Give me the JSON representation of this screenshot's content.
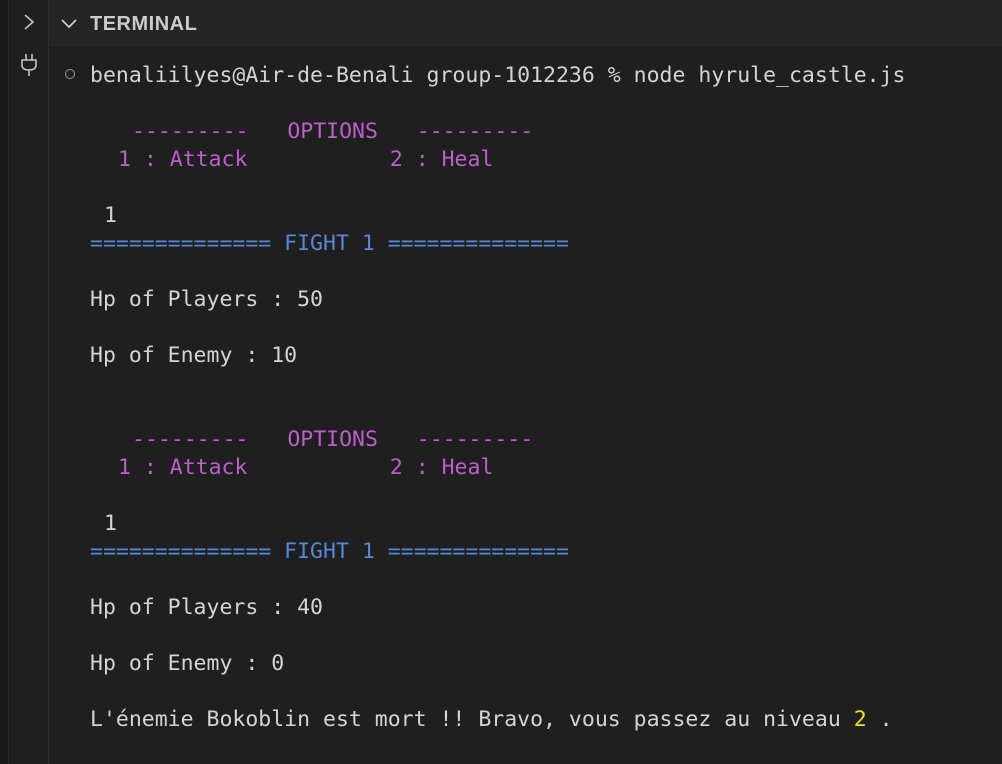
{
  "panel": {
    "title": "TERMINAL"
  },
  "icons": {
    "side_top": "chevron-right-icon",
    "side_plug": "plug-icon",
    "header_chevron": "chevron-down-icon",
    "status": "status-circle-icon"
  },
  "colors": {
    "options": "#bc5fcb",
    "fight": "#5588d6",
    "highlight": "#e5e510",
    "text": "#d4d4d4",
    "background": "#1f1f1f"
  },
  "terminal": {
    "prompt": "benaliilyes@Air-de-Benali group-1012236 % node hyrule_castle.js",
    "rounds": [
      {
        "options_line": "---------   OPTIONS   ---------",
        "choices_line": "1 : Attack           2 : Heal",
        "input": "1",
        "fight_line": "============== FIGHT 1 ==============",
        "hp_players": "Hp of Players : 50",
        "hp_enemy": "Hp of Enemy : 10"
      },
      {
        "options_line": "---------   OPTIONS   ---------",
        "choices_line": "1 : Attack           2 : Heal",
        "input": "1",
        "fight_line": "============== FIGHT 1 ==============",
        "hp_players": "Hp of Players : 40",
        "hp_enemy": "Hp of Enemy : 0"
      }
    ],
    "final_message": {
      "before": "L'énemie Bokoblin est mort !! Bravo, vous passez au niveau ",
      "level": "2",
      "after": " ."
    }
  }
}
